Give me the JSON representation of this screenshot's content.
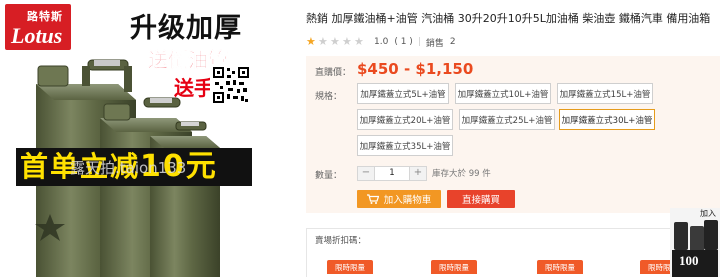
{
  "product_image": {
    "logo_cn": "路特斯",
    "logo_en": "Lotus",
    "headline": "升级加厚",
    "promo_line1": "送倒油管",
    "promo_line2": "送手",
    "banner_text": "首单立减",
    "banner_number": "10元",
    "watermark": "露天拍.taion133"
  },
  "product": {
    "title": "熱銷 加厚鐵油桶+油管 汽油桶 30升20升10升5L加油桶 柴油壺 鐵桶汽車 備用油箱",
    "rating_value": "1.0",
    "review_count": "( 1 )",
    "sold_label": "銷售",
    "sold_count": "2",
    "rating_stars": 1,
    "rating_max": 5
  },
  "purchase": {
    "price_label": "直購價：",
    "price": "$450 - $1,150",
    "spec_label": "規格：",
    "variants": [
      {
        "label": "加厚鐵蓋立式5L+油管",
        "selected": false
      },
      {
        "label": "加厚鐵蓋立式10L+油管",
        "selected": false
      },
      {
        "label": "加厚鐵蓋立式15L+油管",
        "selected": false
      },
      {
        "label": "加厚鐵蓋立式20L+油管",
        "selected": false
      },
      {
        "label": "加厚鐵蓋立式25L+油管",
        "selected": false
      },
      {
        "label": "加厚鐵蓋立式30L+油管",
        "selected": true
      },
      {
        "label": "加厚鐵蓋立式35L+油管",
        "selected": false
      }
    ],
    "qty_label": "數量：",
    "qty_minus": "−",
    "qty_value": "1",
    "qty_plus": "+",
    "stock_text": "庫存大於 99 件",
    "add_to_cart": "加入購物車",
    "buy_now": "直接購買"
  },
  "coupons": {
    "title": "賣場折扣碼：",
    "items": [
      "限時限量",
      "限時限量",
      "限時限量",
      "限時限量"
    ]
  },
  "side_ad": {
    "caption": "加入",
    "big_text": "100"
  },
  "colors": {
    "price": "#ea4a1f",
    "cart_button": "#f29723",
    "buy_button": "#e8432b",
    "selected_border": "#e59c1d",
    "panel_bg": "#fdf5ef",
    "star_on": "#f5a623"
  },
  "icons": [
    "cart-icon",
    "star-icon",
    "qr-code-icon"
  ]
}
